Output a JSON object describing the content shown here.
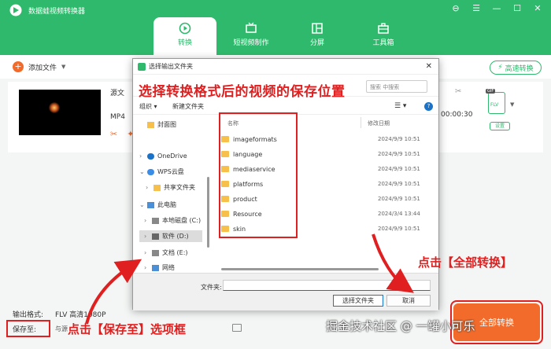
{
  "app": {
    "title": "数据蛙视频转换器",
    "window_controls": [
      "⊖",
      "☰",
      "—",
      "☐",
      "✕"
    ],
    "tabs": [
      {
        "label": "转换",
        "icon": "convert-icon",
        "active": true
      },
      {
        "label": "短视频制作",
        "icon": "short-video-icon",
        "active": false
      },
      {
        "label": "分屏",
        "icon": "split-screen-icon",
        "active": false
      },
      {
        "label": "工具箱",
        "icon": "toolbox-icon",
        "active": false
      }
    ]
  },
  "toolbar": {
    "add_file": "添加文件",
    "add_file_caret": "▼",
    "speed_convert": "高速转换"
  },
  "file": {
    "source_label": "源文",
    "format": "MP4",
    "duration": "00:00:30",
    "scissors": "✂",
    "output_badge": "GIF",
    "output_format": "FLV",
    "output_caret": "▼",
    "settings": "设置",
    "tool_icons": [
      "✂",
      "✦"
    ]
  },
  "bottom": {
    "output_format_label": "输出格式:",
    "output_format_value": "FLV 高清1080P",
    "save_to_label": "保存至:",
    "save_to_value": "与源",
    "convert_button": "全部转换"
  },
  "dialog": {
    "title": "选择输出文件夹",
    "close": "✕",
    "search_placeholder": "搜索 中搜索",
    "organize": "组织 ▾",
    "new_folder": "新建文件夹",
    "view_icon": "☰ ▾",
    "help": "?",
    "nav": [
      {
        "label": "封面图",
        "chev": "",
        "icon": "folder"
      },
      {
        "label": "OneDrive",
        "chev": "›",
        "icon": "cloud"
      },
      {
        "label": "WPS云盘",
        "chev": "⌄",
        "icon": "cloud"
      },
      {
        "label": "共享文件夹",
        "chev": "›",
        "icon": "folder"
      },
      {
        "label": "此电脑",
        "chev": "⌄",
        "icon": "pc"
      },
      {
        "label": "本地磁盘 (C:)",
        "chev": "›",
        "icon": "drive"
      },
      {
        "label": "软件 (D:)",
        "chev": "›",
        "icon": "drive",
        "selected": true
      },
      {
        "label": "文档 (E:)",
        "chev": "›",
        "icon": "drive"
      },
      {
        "label": "网络",
        "chev": "›",
        "icon": "network"
      }
    ],
    "columns": {
      "name": "名称",
      "date": "修改日期"
    },
    "rows": [
      {
        "name": "imageformats",
        "date": "2024/9/9 10:51"
      },
      {
        "name": "language",
        "date": "2024/9/9 10:51"
      },
      {
        "name": "mediaservice",
        "date": "2024/9/9 10:51"
      },
      {
        "name": "platforms",
        "date": "2024/9/9 10:51"
      },
      {
        "name": "product",
        "date": "2024/9/9 10:51"
      },
      {
        "name": "Resource",
        "date": "2024/3/4 13:44"
      },
      {
        "name": "skin",
        "date": "2024/9/9 10:51"
      }
    ],
    "folder_label": "文件夹:",
    "select_button": "选择文件夹",
    "cancel_button": "取消"
  },
  "annotations": {
    "top": "选择转换格式后的视频的保存位置",
    "convert": "点击【全部转换】",
    "save": "点击【保存至】选项框",
    "watermark": "掘金技术社区 @ 一罐小可乐"
  },
  "colors": {
    "brand": "#2fb96c",
    "accent": "#f26b2a",
    "annotation": "#e02020"
  }
}
